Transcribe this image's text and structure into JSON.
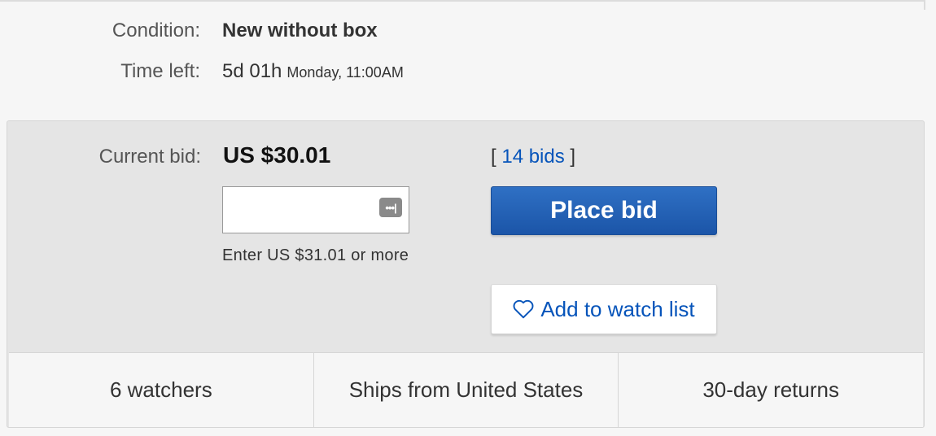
{
  "condition": {
    "label": "Condition:",
    "value": "New without box"
  },
  "time_left": {
    "label": "Time left:",
    "value": "5d 01h",
    "detail": "Monday, 11:00AM"
  },
  "bid": {
    "label": "Current bid:",
    "amount": "US $30.01",
    "bids_open": "[",
    "bids_link": "14 bids",
    "bids_close": "]",
    "input_value": "",
    "hint": "Enter US $31.01 or more",
    "place_bid_label": "Place bid",
    "watch_label": "Add to watch list"
  },
  "features": [
    {
      "label": "6 watchers"
    },
    {
      "label": "Ships from United States"
    },
    {
      "label": "30-day returns"
    }
  ],
  "colors": {
    "link_blue": "#0654ba",
    "button_blue": "#1b55a8",
    "panel_gray": "#e5e5e5"
  }
}
